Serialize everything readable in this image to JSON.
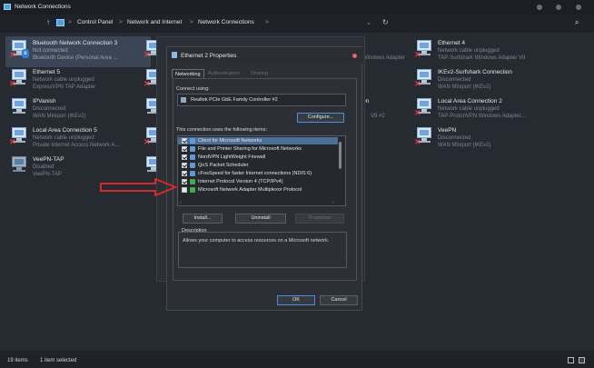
{
  "window": {
    "title": "Network Connections",
    "controls": [
      "minimize-dot",
      "maximize-dot",
      "close-dot"
    ]
  },
  "address": {
    "crumbs": [
      "Control Panel",
      "Network and Internet",
      "Network Connections"
    ],
    "separator": ">"
  },
  "connections": [
    {
      "name": "Bluetooth Network Connection 3",
      "status": "Not connected",
      "adapter": "Bluetooth Device (Personal Area ...",
      "selected": true,
      "icon": "bluetooth-adapter-icon"
    },
    {
      "name": "Ethernet 5",
      "status": "Network cable unplugged",
      "adapter": "ExpressVPN TAP Adapter",
      "selected": false,
      "icon": "network-adapter-icon"
    },
    {
      "name": "IPVanish",
      "status": "Disconnected",
      "adapter": "WAN Miniport (IKEv2)",
      "selected": false,
      "icon": "network-adapter-icon"
    },
    {
      "name": "Local Area Connection 5",
      "status": "Network cable unplugged",
      "adapter": "Private Internet Access Network A...",
      "selected": false,
      "icon": "network-adapter-icon"
    },
    {
      "name": "VeePN-TAP",
      "status": "Disabled",
      "adapter": "VeePN-TAP",
      "selected": false,
      "icon": "network-adapter-icon"
    },
    {
      "name": "Ethernet 4",
      "status": "Network cable unplugged",
      "adapter": "TAP-Surfshark Windows Adapter V9",
      "selected": false,
      "icon": "network-adapter-icon"
    },
    {
      "name": "IKEv2-Surfshark Connection",
      "status": "Disconnected",
      "adapter": "WAN Miniport (IKEv2)",
      "selected": false,
      "icon": "network-adapter-icon"
    },
    {
      "name": "Local Area Connection 2",
      "status": "Network cable unplugged",
      "adapter": "TAP-ProtonVPN Windows Adapter...",
      "selected": false,
      "icon": "network-adapter-icon"
    },
    {
      "name": "VeePN",
      "status": "Disconnected",
      "adapter": "WAN Miniport (IKEv2)",
      "selected": false,
      "icon": "network-adapter-icon"
    }
  ],
  "middle_column_peek": {
    "adapter_l1": "Windows Adapter",
    "name_l2": "on",
    "adapter_l3": "V9 #2"
  },
  "status_bar": {
    "item_count": "19 items",
    "selection": "1 item selected"
  },
  "dialog": {
    "title": "Ethernet 2 Properties",
    "tabs": [
      "Networking",
      "Authentication",
      "Sharing"
    ],
    "active_tab": "Networking",
    "connect_using_label": "Connect using:",
    "adapter": "Realtek PCIe GbE Family Controller #2",
    "configure_button": "Configure...",
    "items_label": "This connection uses the following items:",
    "items": [
      {
        "label": "Client for Microsoft Networks",
        "checked": true,
        "selected": true,
        "icon_color": "#5b9bd5"
      },
      {
        "label": "File and Printer Sharing for Microsoft Networks",
        "checked": true,
        "selected": false,
        "icon_color": "#5b9bd5"
      },
      {
        "label": "NordVPN LightWeight Firewall",
        "checked": true,
        "selected": false,
        "icon_color": "#5b9bd5"
      },
      {
        "label": "QoS Packet Scheduler",
        "checked": true,
        "selected": false,
        "icon_color": "#5b9bd5"
      },
      {
        "label": "cFosSpeed for faster Internet connections (NDIS 6)",
        "checked": true,
        "selected": false,
        "icon_color": "#5b9bd5"
      },
      {
        "label": "Internet Protocol Version 4 (TCP/IPv4)",
        "checked": true,
        "selected": false,
        "icon_color": "#3fae49"
      },
      {
        "label": "Microsoft Network Adapter Multiplexor Protocol",
        "checked": false,
        "selected": false,
        "icon_color": "#3fae49"
      }
    ],
    "install_button": "Install...",
    "uninstall_button": "Uninstall",
    "properties_button": "Properties",
    "description_label": "Description",
    "description_text": "Allows your computer to access resources on a Microsoft network.",
    "ok_button": "OK",
    "cancel_button": "Cancel"
  },
  "colors": {
    "accent": "#4a90d9",
    "selected_row": "#4c6e96",
    "error_x": "#e23b3b",
    "arrow": "#d62a2a"
  }
}
